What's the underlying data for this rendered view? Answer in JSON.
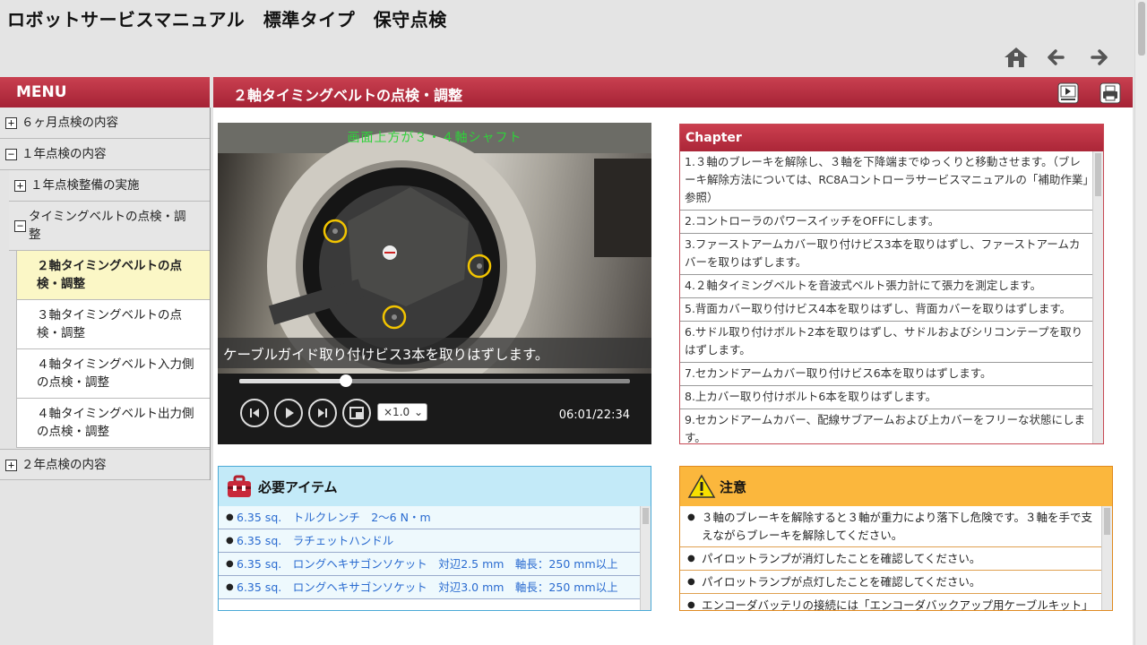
{
  "app": {
    "title": "ロボットサービスマニュアル　標準タイプ　保守点検"
  },
  "topnav": {
    "home_icon": "home-icon",
    "back_icon": "arrow-left-icon",
    "forward_icon": "arrow-right-icon"
  },
  "sidebar": {
    "header": "MENU",
    "items": [
      {
        "label": "６ヶ月点検の内容",
        "toggle": "+"
      },
      {
        "label": "１年点検の内容",
        "toggle": "−"
      },
      {
        "label": "１年点検整備の実施",
        "toggle": "+"
      },
      {
        "label": "タイミングベルトの点検・調整",
        "toggle": "−"
      },
      {
        "label": "２軸タイミングベルトの点検・調整"
      },
      {
        "label": "３軸タイミングベルトの点検・調整"
      },
      {
        "label": "４軸タイミングベルト入力側の点検・調整"
      },
      {
        "label": "４軸タイミングベルト出力側の点検・調整"
      },
      {
        "label": "２年点検の内容",
        "toggle": "+"
      }
    ]
  },
  "content": {
    "title": "２軸タイミングベルトの点検・調整",
    "video_icon": "video-icon",
    "print_icon": "print-icon"
  },
  "video": {
    "overlay_top": "画面上方が３・４軸シャフト",
    "subtitle": "ケーブルガイド取り付けビス3本を取りはずします。",
    "progress": 0.274,
    "speed": "×1.0",
    "time": "06:01/22:34"
  },
  "chapter": {
    "header": "Chapter",
    "items": [
      "1.３軸のブレーキを解除し、３軸を下降端までゆっくりと移動させます。（ブレーキ解除方法については、RC8Aコントローラサービスマニュアルの「補助作業」参照）",
      "2.コントローラのパワースイッチをOFFにします。",
      "3.ファーストアームカバー取り付けビス3本を取りはずし、ファーストアームカバーを取りはずします。",
      "4.２軸タイミングベルトを音波式ベルト張力計にて張力を測定します。",
      "5.背面カバー取り付けビス4本を取りはずし、背面カバーを取りはずします。",
      "6.サドル取り付けボルト2本を取りはずし、サドルおよびシリコンテープを取りはずします。",
      "7.セカンドアームカバー取り付けビス6本を取りはずします。",
      "8.上カバー取り付けボルト6本を取りはずします。",
      "9.セカンドアームカバー、配線サブアームおよび上カバーをフリーな状態にします。"
    ]
  },
  "items": {
    "header": "必要アイテム",
    "icon": "toolbox-icon",
    "list": [
      "6.35 sq.　トルクレンチ　2～6 N・m",
      "6.35 sq.　ラチェットハンドル",
      "6.35 sq.　ロングヘキサゴンソケット　対辺2.5 mm　軸長：250 mm以上",
      "6.35 sq.　ロングヘキサゴンソケット　対辺3.0 mm　軸長：250 mm以上"
    ]
  },
  "caution": {
    "header": "注意",
    "icon": "warning-icon",
    "list": [
      "３軸のブレーキを解除すると３軸が重力により落下し危険です。３軸を手で支えながらブレーキを解除してください。",
      "パイロットランプが消灯したことを確認してください。",
      "パイロットランプが点灯したことを確認してください。",
      "エンコーダバッテリの接続には「エンコーダバックアップ用ケーブルキット」を使用してください。"
    ]
  },
  "colors": {
    "header_red": "#b42e40",
    "items_blue": "#c3eaf8",
    "caution_orange": "#fbb73d",
    "overlay_green": "#2fd23a",
    "active_yellow": "#fbf7c6"
  }
}
